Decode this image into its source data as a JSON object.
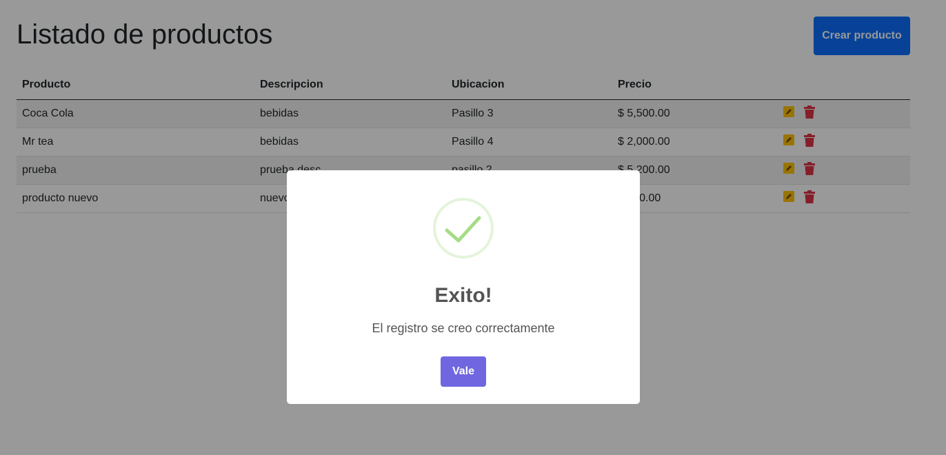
{
  "page": {
    "title": "Listado de productos",
    "create_button": "Crear producto"
  },
  "table": {
    "headers": [
      "Producto",
      "Descripcion",
      "Ubicacion",
      "Precio",
      ""
    ],
    "rows": [
      {
        "producto": "Coca Cola",
        "descripcion": "bebidas",
        "ubicacion": "Pasillo 3",
        "precio": "$ 5,500.00"
      },
      {
        "producto": "Mr tea",
        "descripcion": "bebidas",
        "ubicacion": "Pasillo 4",
        "precio": "$ 2,000.00"
      },
      {
        "producto": "prueba",
        "descripcion": "prueba desc",
        "ubicacion": "pasillo 2",
        "precio": "$ 5,200.00"
      },
      {
        "producto": "producto nuevo",
        "descripcion": "nuevo",
        "ubicacion": "",
        "precio": "$ 000.00"
      }
    ],
    "row_actions": {
      "edit_icon": "pencil-icon",
      "delete_icon": "trash-icon"
    }
  },
  "modal": {
    "title": "Exito!",
    "message": "El registro se creo correctamente",
    "confirm_button": "Vale",
    "icon": "success-check-icon"
  },
  "colors": {
    "primary": "#0d6efd",
    "edit": "#ffc107",
    "delete": "#dc3545",
    "confirm": "#7066e0",
    "success": "#a5dc86"
  }
}
